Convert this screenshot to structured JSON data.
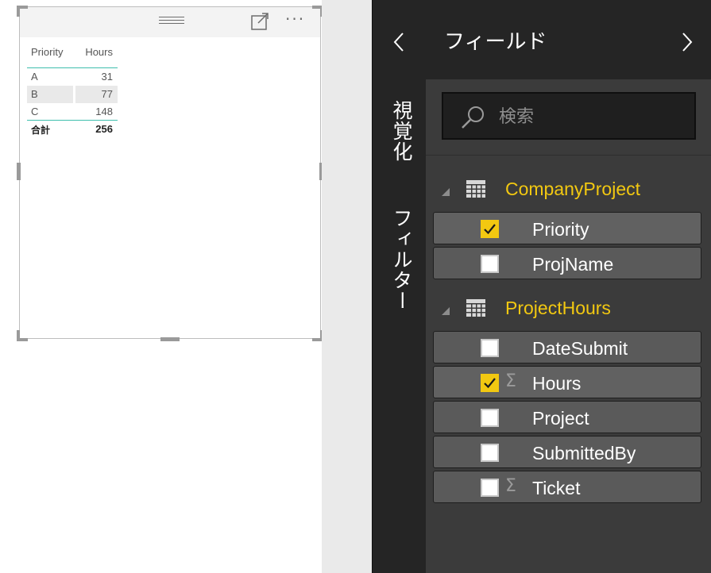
{
  "visual": {
    "table": {
      "headers": [
        "Priority",
        "Hours"
      ],
      "rows": [
        {
          "priority": "A",
          "hours": "31"
        },
        {
          "priority": "B",
          "hours": "77"
        },
        {
          "priority": "C",
          "hours": "148"
        }
      ],
      "total_label": "合計",
      "total_value": "256"
    },
    "more_label": "···"
  },
  "rail": {
    "visualizations_label": "視覚化",
    "filters_label": "フィルター"
  },
  "fields_panel": {
    "title": "フィールド",
    "search_placeholder": "検索",
    "tables": [
      {
        "name": "CompanyProject",
        "fields": [
          {
            "name": "Priority",
            "checked": true,
            "sigma": false
          },
          {
            "name": "ProjName",
            "checked": false,
            "sigma": false
          }
        ]
      },
      {
        "name": "ProjectHours",
        "fields": [
          {
            "name": "DateSubmit",
            "checked": false,
            "sigma": false
          },
          {
            "name": "Hours",
            "checked": true,
            "sigma": true
          },
          {
            "name": "Project",
            "checked": false,
            "sigma": false
          },
          {
            "name": "SubmittedBy",
            "checked": false,
            "sigma": false
          },
          {
            "name": "Ticket",
            "checked": false,
            "sigma": true
          }
        ]
      }
    ],
    "sigma_glyph": "Σ"
  },
  "colors": {
    "accent_yellow": "#f2c811",
    "table_rule_teal": "#3fbfad",
    "panel_dark": "#252525",
    "panel_mid": "#3b3b3b"
  }
}
